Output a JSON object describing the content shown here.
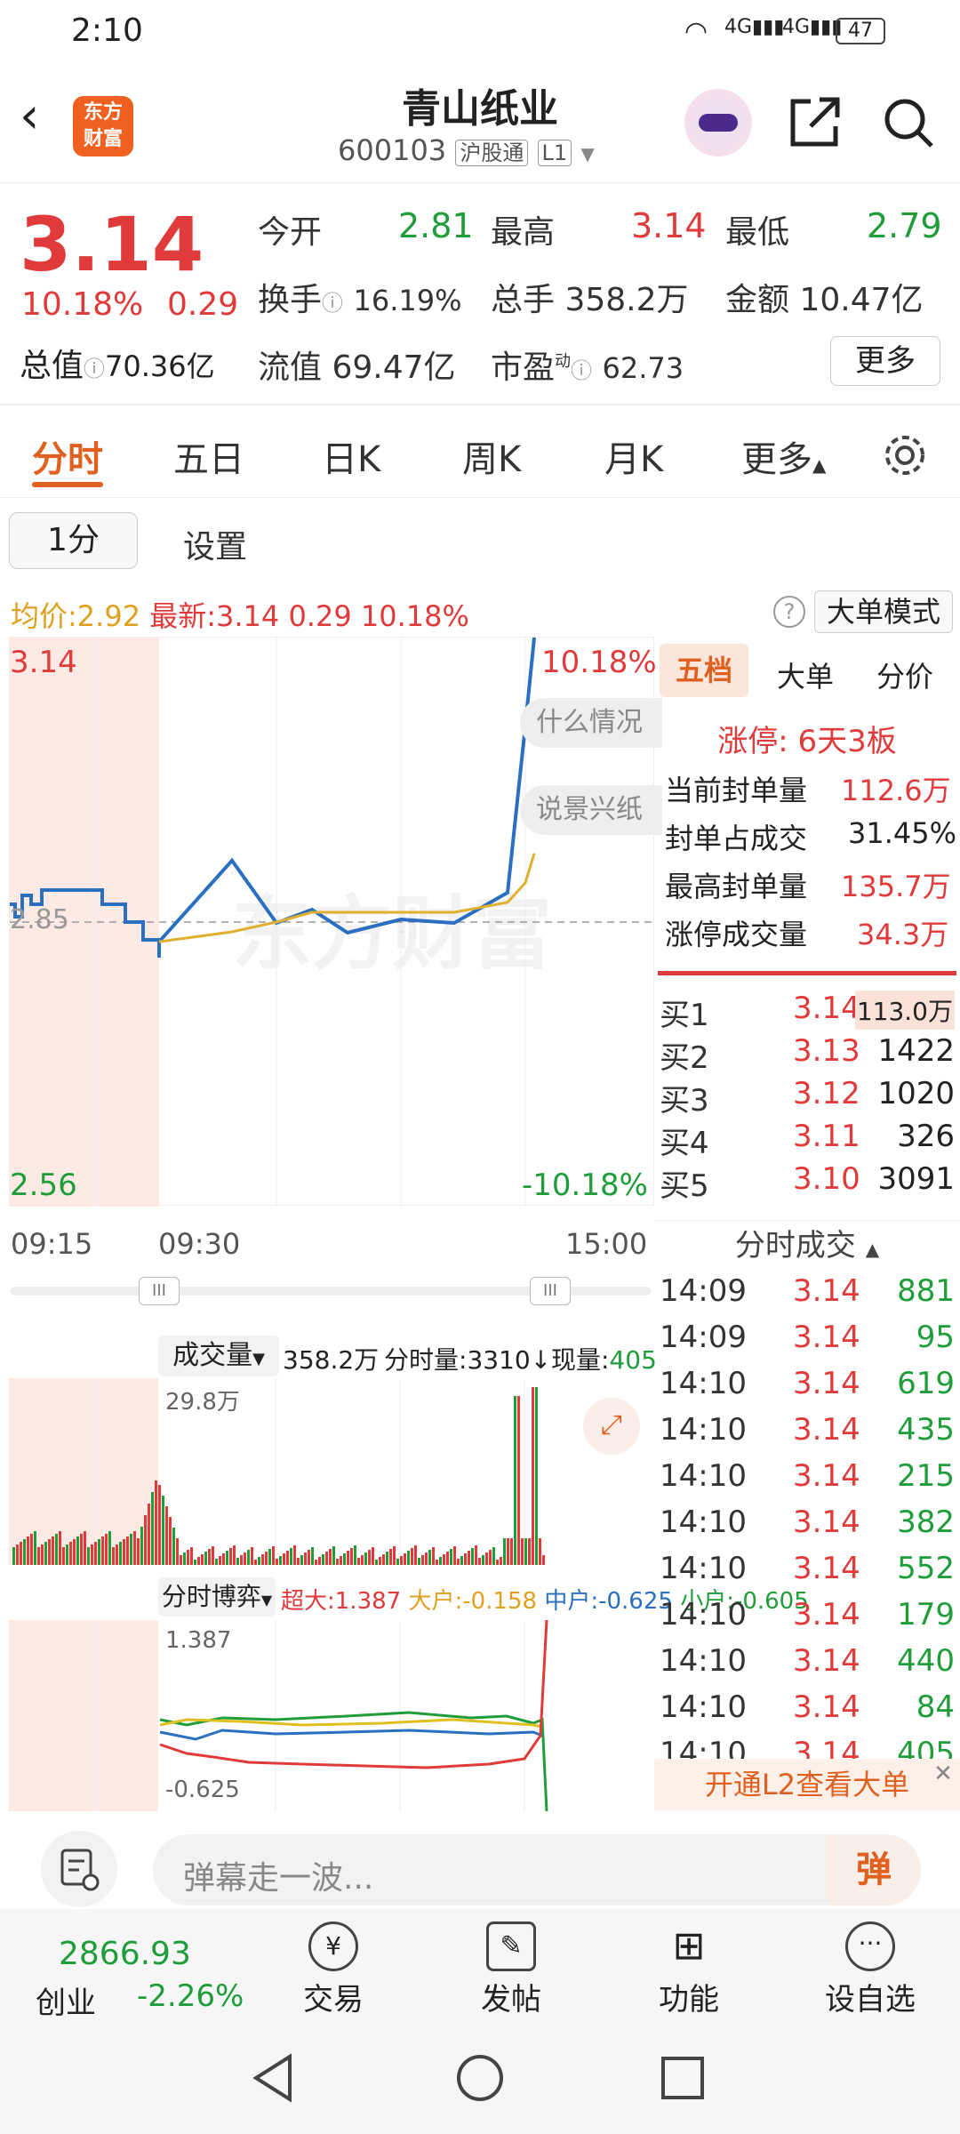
{
  "status_bar": {
    "time": "2:10",
    "battery": "47"
  },
  "header": {
    "brand_line1": "东方",
    "brand_line2": "财富",
    "stock_name": "青山纸业",
    "stock_code": "600103",
    "market_badge": "沪股通",
    "level_badge": "L1"
  },
  "quote": {
    "price": "3.14",
    "change_pct": "10.18%",
    "change": "0.29",
    "open_label": "今开",
    "open": "2.81",
    "high_label": "最高",
    "high": "3.14",
    "low_label": "最低",
    "low": "2.79",
    "turnover_label": "换手",
    "turnover": "16.19%",
    "volume_label": "总手",
    "volume": "358.2万",
    "amount_label": "金额",
    "amount": "10.47亿",
    "mktcap_label": "总值",
    "mktcap": "70.36亿",
    "float_label": "流值",
    "float": "69.47亿",
    "pe_label": "市盈",
    "pe_sup": "动",
    "pe": "62.73",
    "more_button": "更多"
  },
  "tabs": {
    "t1": "分时",
    "t2": "五日",
    "t3": "日K",
    "t4": "周K",
    "t5": "月K",
    "t6": "更多"
  },
  "sub": {
    "interval": "1分",
    "settings": "设置"
  },
  "legend": {
    "avg_label": "均价:",
    "avg": "2.92",
    "last_label": "最新:",
    "last": "3.14",
    "chg": "0.29",
    "pct": "10.18%",
    "big_mode": "大单模式"
  },
  "chart": {
    "top_price": "3.14",
    "bottom_price": "2.56",
    "mid_price": "2.85",
    "top_pct": "10.18%",
    "bottom_pct": "-10.18%",
    "t_start": "09:15",
    "t_open": "09:30",
    "t_end": "15:00",
    "bubble1": "什么情况",
    "bubble2": "说景兴纸",
    "watermark": "东方财富"
  },
  "chart_data": {
    "type": "line",
    "x": [
      "09:30",
      "10:00",
      "10:30",
      "11:00",
      "11:30",
      "13:00",
      "13:30",
      "14:00",
      "14:05",
      "14:10"
    ],
    "series": [
      {
        "values": [
          2.83,
          2.9,
          2.86,
          2.85,
          2.85,
          2.84,
          2.86,
          2.88,
          3.05,
          3.14
        ]
      },
      {
        "values": [
          2.83,
          2.84,
          2.85,
          2.86,
          2.86,
          2.86,
          2.86,
          2.87,
          2.89,
          2.92
        ]
      }
    ],
    "ylim": [
      2.56,
      3.14
    ]
  },
  "side": {
    "tab1": "五档",
    "tab2": "大单",
    "tab3": "分价",
    "limit_up": "涨停: 6天3板",
    "seal_vol_label": "当前封单量",
    "seal_vol": "112.6万",
    "seal_ratio_label": "封单占成交",
    "seal_ratio": "31.45%",
    "max_seal_label": "最高封单量",
    "max_seal": "135.7万",
    "limit_vol_label": "涨停成交量",
    "limit_vol": "34.3万",
    "bids": [
      {
        "label": "买1",
        "price": "3.14",
        "vol": "113.0万"
      },
      {
        "label": "买2",
        "price": "3.13",
        "vol": "1422"
      },
      {
        "label": "买3",
        "price": "3.12",
        "vol": "1020"
      },
      {
        "label": "买4",
        "price": "3.11",
        "vol": "326"
      },
      {
        "label": "买5",
        "price": "3.10",
        "vol": "3091"
      }
    ],
    "ticks_title": "分时成交",
    "ticks": [
      {
        "t": "14:09",
        "p": "3.14",
        "v": "881"
      },
      {
        "t": "14:09",
        "p": "3.14",
        "v": "95"
      },
      {
        "t": "14:10",
        "p": "3.14",
        "v": "619"
      },
      {
        "t": "14:10",
        "p": "3.14",
        "v": "435"
      },
      {
        "t": "14:10",
        "p": "3.14",
        "v": "215"
      },
      {
        "t": "14:10",
        "p": "3.14",
        "v": "382"
      },
      {
        "t": "14:10",
        "p": "3.14",
        "v": "552"
      },
      {
        "t": "14:10",
        "p": "3.14",
        "v": "179"
      },
      {
        "t": "14:10",
        "p": "3.14",
        "v": "440"
      },
      {
        "t": "14:10",
        "p": "3.14",
        "v": "84"
      },
      {
        "t": "14:10",
        "p": "3.14",
        "v": "405"
      }
    ],
    "l2_banner": "开通L2查看大单"
  },
  "volume": {
    "selector": "成交量",
    "total": "358.2万",
    "minute_label": "分时量:",
    "minute": "3310",
    "now_label": "现量:",
    "now": "405",
    "max": "29.8万"
  },
  "flow": {
    "selector": "分时博弈",
    "super_label": "超大:",
    "super": "1.387",
    "big_label": "大户:",
    "big": "-0.158",
    "mid_label": "中户:",
    "mid": "-0.625",
    "small_label": "小户:",
    "small": "-0.605",
    "top": "1.387",
    "bottom": "-0.625"
  },
  "input": {
    "placeholder": "弹幕走一波...",
    "danmu_btn": "弹"
  },
  "nav": {
    "index_value": "2866.93",
    "index_name": "创业",
    "index_pct": "-2.26%",
    "trade": "交易",
    "post": "发帖",
    "func": "功能",
    "watch": "设自选"
  }
}
